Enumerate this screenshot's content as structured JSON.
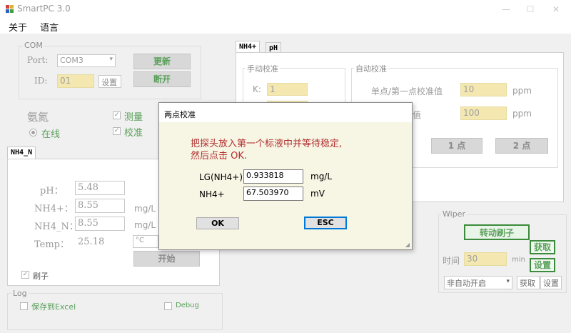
{
  "window": {
    "title": "SmartPC 3.0"
  },
  "menu": {
    "items": [
      "关于",
      "语言"
    ]
  },
  "com": {
    "legend": "COM",
    "port_label": "Port:",
    "port_value": "COM3",
    "id_label": "ID:",
    "id_value": "01",
    "set_label": "设置",
    "refresh_label": "更新",
    "disconnect_label": "断开"
  },
  "status": {
    "sensor_name": "氨氮",
    "online_label": "在线",
    "measure_label": "测量",
    "calibrate_label": "校准"
  },
  "left_tab": {
    "tab_label": "NH4_N",
    "rows": [
      {
        "label": "pH：",
        "value": "5.48",
        "unit": ""
      },
      {
        "label": "NH4+：",
        "value": "8.55",
        "unit": "mg/L"
      },
      {
        "label": "NH4_N：",
        "value": "8.55",
        "unit": "mg/L"
      },
      {
        "label": "Temp：",
        "value": "25.18",
        "unit": "°C"
      }
    ],
    "start_label": "开始",
    "brush_label": "刷子"
  },
  "log": {
    "legend": "Log",
    "excel_label": "保存到Excel",
    "debug_label": "Debug"
  },
  "right_tabs": {
    "tabs": [
      "NH4+",
      "pH"
    ],
    "manual": {
      "legend": "手动校准",
      "k_label": "K:",
      "k_value": "1"
    },
    "auto": {
      "legend": "自动校准",
      "single_label": "单点/第一点校准值",
      "single_value": "10",
      "single_unit": "ppm",
      "second_label": "值",
      "second_value": "100",
      "second_unit": "ppm",
      "one_point_label": "1 点",
      "two_point_label": "2 点"
    }
  },
  "wiper": {
    "legend": "Wiper",
    "rotate_label": "转动刷子",
    "get_label": "获取",
    "set_label": "设置",
    "time_label": "时间",
    "time_value": "30",
    "time_unit": "min",
    "mode_value": "非自动开启",
    "get2_label": "获取",
    "set2_label": "设置"
  },
  "dialog": {
    "title": "两点校准",
    "message_line1": "把探头放入第一个标液中并等待稳定,",
    "message_line2": "然后点击 OK.",
    "lg_label": "LG(NH4+)",
    "lg_value": "0.933818",
    "lg_unit": "mg/L",
    "nh4_label": "NH4+",
    "nh4_value": "67.503970",
    "nh4_unit": "mV",
    "ok_label": "OK",
    "esc_label": "ESC"
  }
}
